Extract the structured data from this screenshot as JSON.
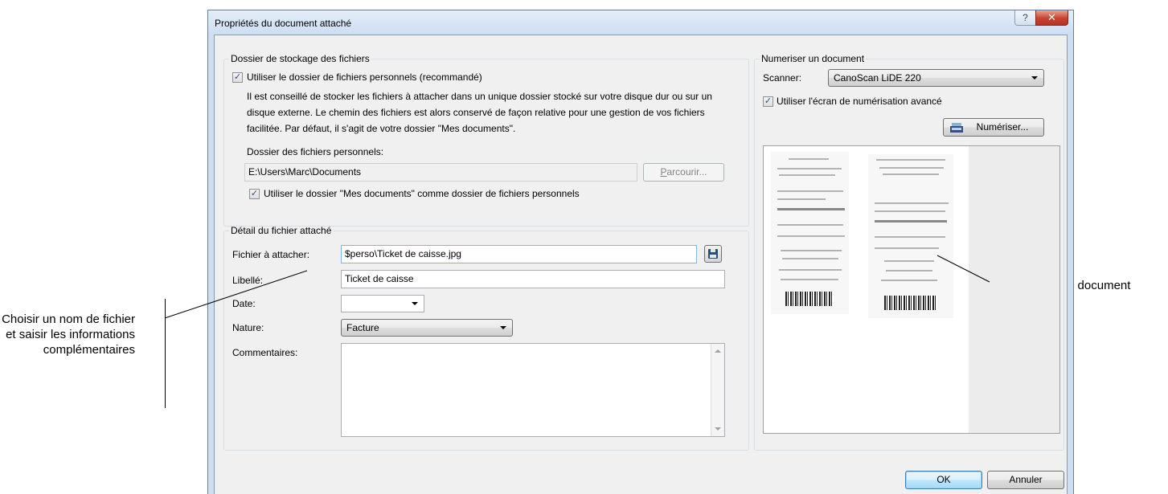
{
  "callouts": {
    "left": "Choisir un nom de fichier et saisir les informations complémentaires",
    "right": "Aperçu du document numérisé"
  },
  "dialog": {
    "title": "Propriétés du document attaché",
    "help_glyph": "?",
    "close_glyph": "✕"
  },
  "storage": {
    "legend": "Dossier de stockage des fichiers",
    "use_personal_folder_label": "Utiliser le dossier de fichiers personnels (recommandé)",
    "use_personal_folder_checked": true,
    "description": "Il est conseillé de stocker les fichiers à attacher dans un unique dossier stocké sur votre disque dur ou sur un disque externe. Le chemin des fichiers est alors conservé de façon relative pour une gestion de vos fichiers facilitée. Par défaut, il s'agit de votre dossier \"Mes documents\".",
    "folder_label": "Dossier des fichiers personnels:",
    "folder_value": "E:\\Users\\Marc\\Documents",
    "browse_label": "Parcourir...",
    "use_my_documents_label": "Utiliser le dossier \"Mes documents\" comme dossier de fichiers personnels",
    "use_my_documents_checked": true
  },
  "detail": {
    "legend": "Détail du fichier attaché",
    "file_label": "Fichier à attacher:",
    "file_value": "$perso\\Ticket de caisse.jpg",
    "libelle_label": "Libellé:",
    "libelle_value": "Ticket de caisse",
    "date_label": "Date:",
    "date_value": "",
    "nature_label": "Nature:",
    "nature_value": "Facture",
    "comments_label": "Commentaires:",
    "comments_value": ""
  },
  "scan": {
    "legend": "Numeriser un document",
    "scanner_label": "Scanner:",
    "scanner_value": "CanoScan LiDE 220",
    "advanced_label": "Utiliser l'écran de numérisation avancé",
    "advanced_checked": true,
    "scan_button": "Numériser..."
  },
  "footer": {
    "ok": "OK",
    "cancel": "Annuler"
  }
}
